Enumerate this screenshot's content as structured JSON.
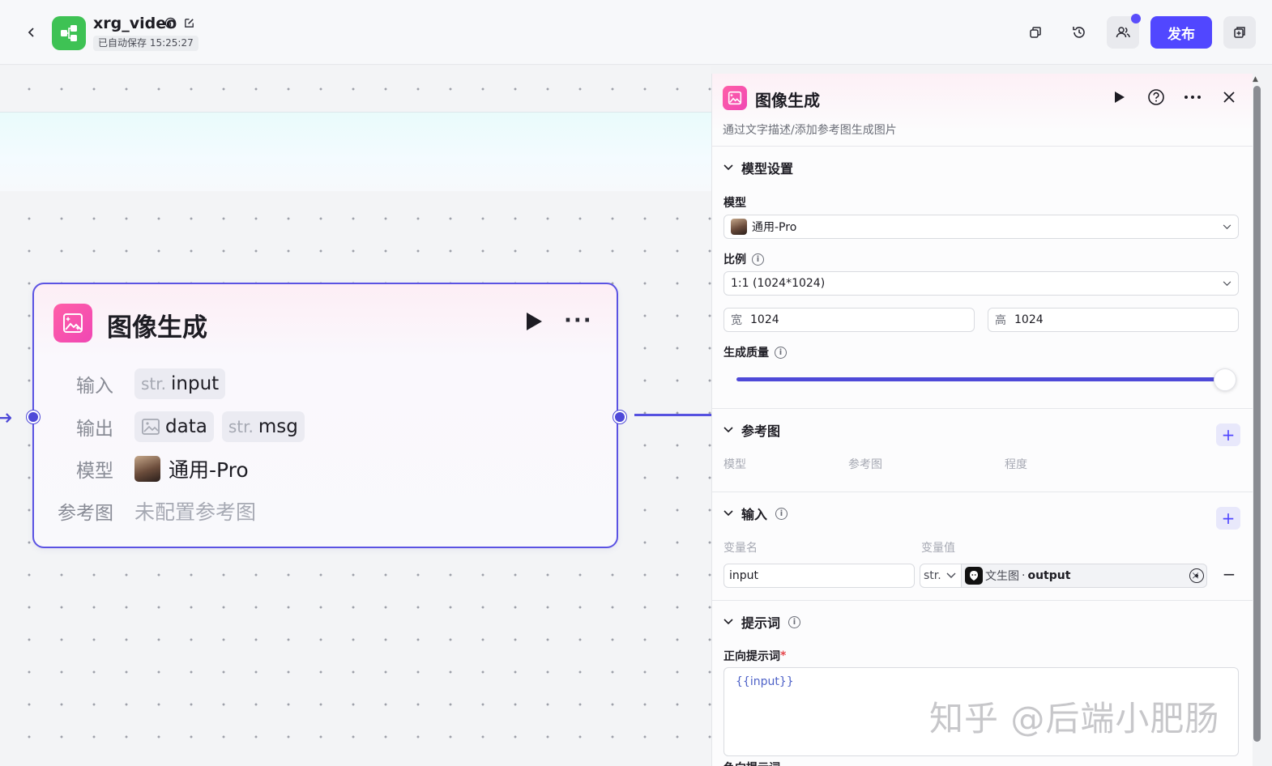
{
  "header": {
    "app_title": "xrg_video",
    "autosave_text": "已自动保存 15:25:27",
    "publish_label": "发布",
    "accent_color": "#5147ff",
    "app_icon_color": "#3ec254"
  },
  "node": {
    "title": "图像生成",
    "input_label": "输入",
    "input_type": "str.",
    "input_name": "input",
    "output_label": "输出",
    "output_1_name": "data",
    "output_2_type": "str.",
    "output_2_name": "msg",
    "model_label": "模型",
    "model_value": "通用-Pro",
    "ref_label": "参考图",
    "ref_value": "未配置参考图"
  },
  "panel": {
    "title": "图像生成",
    "description": "通过文字描述/添加参考图生成图片",
    "model_section": {
      "title": "模型设置",
      "model_label": "模型",
      "model_value": "通用-Pro",
      "ratio_label": "比例",
      "ratio_value": "1:1 (1024*1024)",
      "width_prefix": "宽",
      "width_value": "1024",
      "height_prefix": "高",
      "height_value": "1024",
      "quality_label": "生成质量",
      "quality_level": 1.0
    },
    "ref_section": {
      "title": "参考图",
      "add_label": "+",
      "col_model": "模型",
      "col_ref": "参考图",
      "col_degree": "程度"
    },
    "input_section": {
      "title": "输入",
      "add_label": "+",
      "col_name": "变量名",
      "col_value": "变量值",
      "var_name": "input",
      "var_type": "str.",
      "ref_node": "文生图",
      "ref_separator": "·",
      "ref_var": "output",
      "clear_label": "×",
      "remove_label": "−"
    },
    "prompt_section": {
      "title": "提示词",
      "positive_label": "正向提示词",
      "required_mark": "*",
      "positive_value": "{{input}}",
      "negative_label": "负向提示词"
    }
  },
  "watermark": "知乎 @后端小肥肠"
}
